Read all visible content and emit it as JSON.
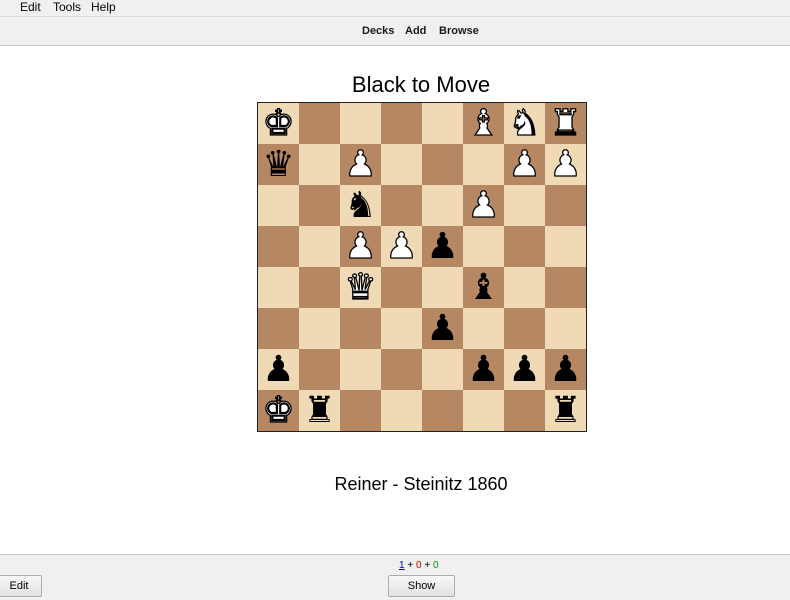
{
  "menu": {
    "items": [
      {
        "label": "File",
        "visible_text": "e"
      },
      {
        "label": "Edit"
      },
      {
        "label": "Tools"
      },
      {
        "label": "Help"
      }
    ]
  },
  "toolbar": {
    "decks": "Decks",
    "add": "Add",
    "browse": "Browse"
  },
  "card": {
    "title": "Black to Move",
    "caption": "Reiner - Steinitz 1860",
    "board": {
      "light_color": "#f0d9b5",
      "dark_color": "#b58863",
      "ranks": [
        [
          "wK",
          "",
          "",
          "",
          "",
          "wB",
          "wN",
          "wR"
        ],
        [
          "bQ",
          "",
          "wP",
          "",
          "",
          "",
          "wP",
          "wP"
        ],
        [
          "",
          "",
          "bN",
          "",
          "",
          "wP",
          "",
          ""
        ],
        [
          "",
          "",
          "wP",
          "wP",
          "bP",
          "",
          "",
          ""
        ],
        [
          "",
          "",
          "wQ",
          "",
          "",
          "bB",
          "",
          ""
        ],
        [
          "",
          "",
          "",
          "",
          "bP",
          "",
          "",
          ""
        ],
        [
          "bP",
          "",
          "",
          "",
          "",
          "bP",
          "bP",
          "bP"
        ],
        [
          "wK",
          "bR",
          "",
          "",
          "",
          "",
          "",
          "bR"
        ]
      ]
    }
  },
  "bottom": {
    "counts": {
      "new": "1",
      "learn": "0",
      "review": "0"
    },
    "count_colors": {
      "new": "#0000cc",
      "learn": "#cc0000",
      "review": "#009900"
    },
    "edit_label": "Edit",
    "show_answer_label": "Show Answer"
  }
}
